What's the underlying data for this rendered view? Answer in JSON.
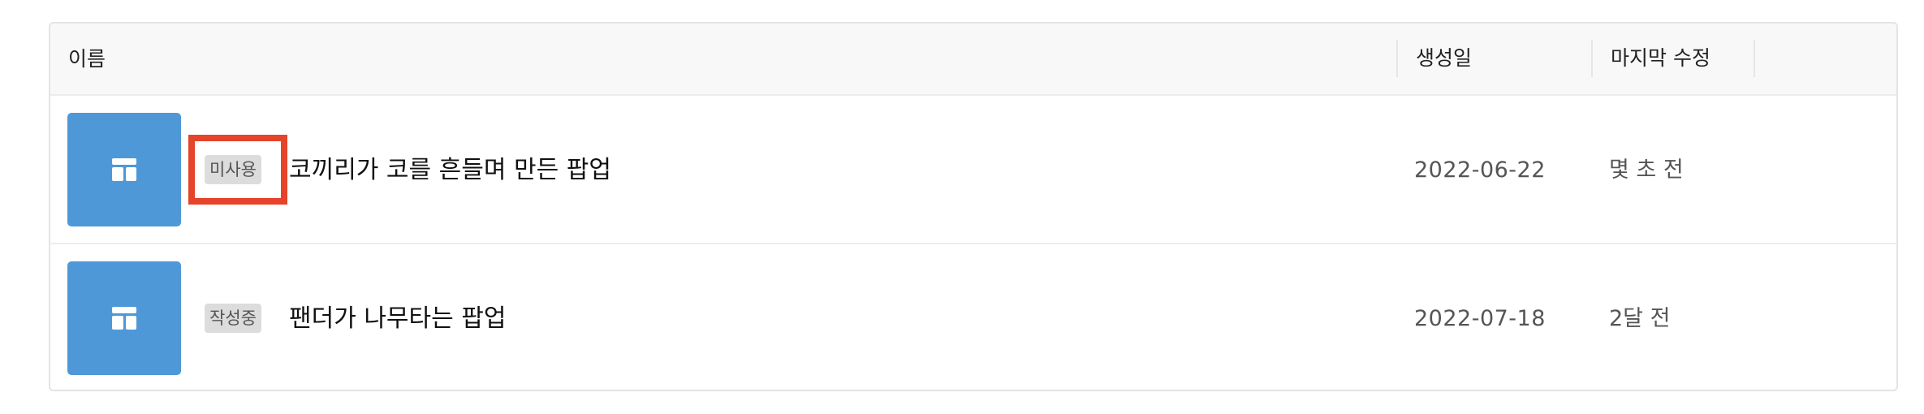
{
  "table": {
    "columns": {
      "name": "이름",
      "created": "생성일",
      "modified": "마지막 수정"
    },
    "rows": [
      {
        "status": "미사용",
        "title": "코끼리가 코를 흔들며 만든 팝업",
        "created": "2022-06-22",
        "modified": "몇 초 전",
        "thumbnail_icon": "layout-template-icon",
        "highlighted": true
      },
      {
        "status": "작성중",
        "title": "팬더가 나무타는 팝업",
        "created": "2022-07-18",
        "modified": "2달 전",
        "thumbnail_icon": "layout-template-icon",
        "highlighted": false
      }
    ]
  },
  "colors": {
    "thumbnail": "#4f98d8",
    "highlight": "#e5432a",
    "badge_bg": "#dcdcdc"
  }
}
